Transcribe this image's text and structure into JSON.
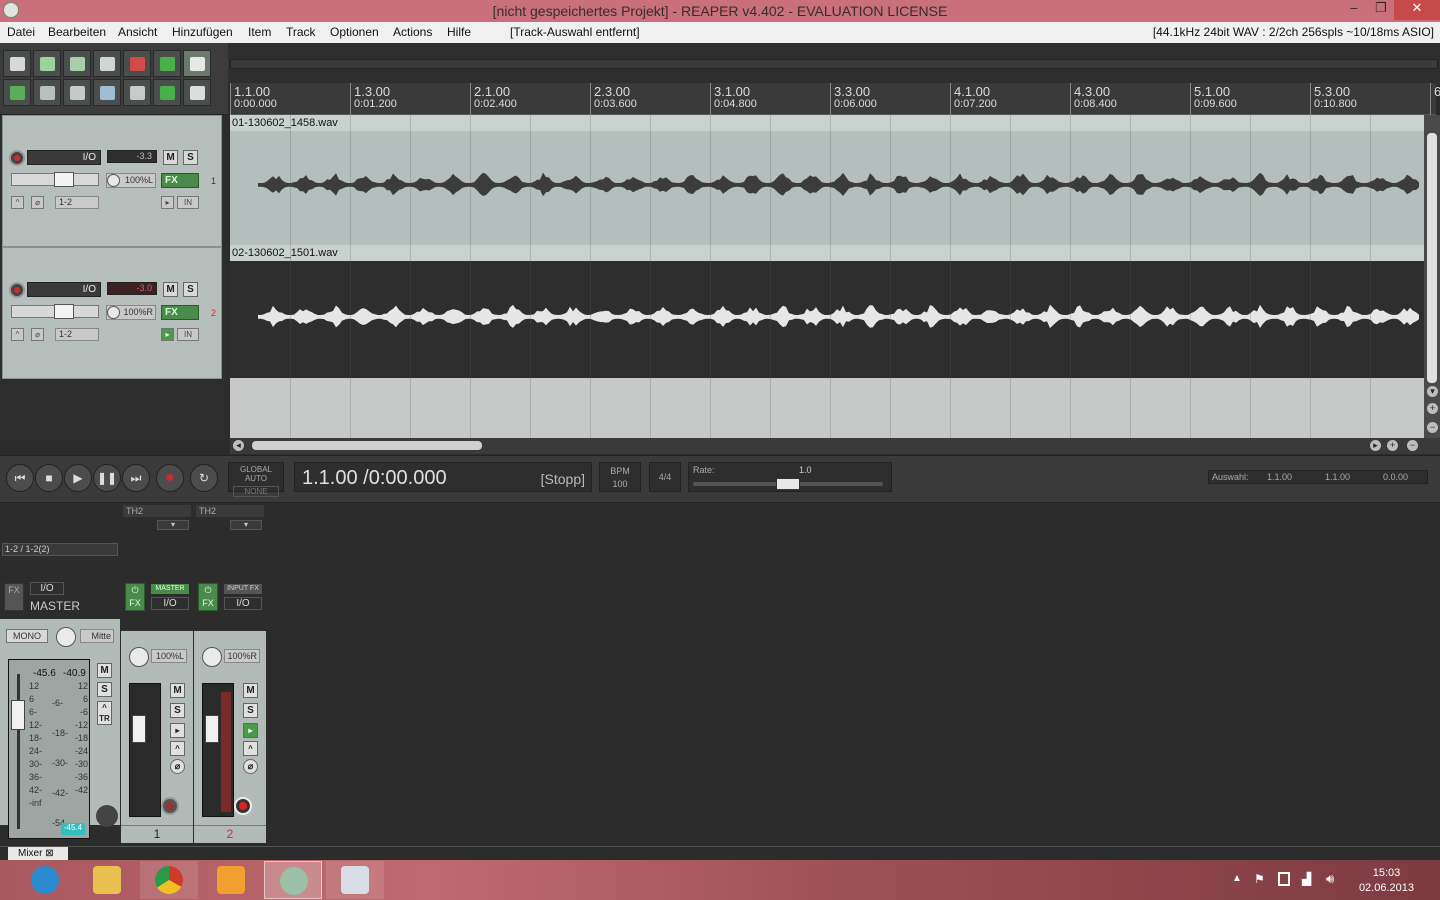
{
  "window": {
    "title": "[nicht gespeichertes Projekt] - REAPER v4.402 - EVALUATION LICENSE",
    "controls": [
      "–",
      "❐",
      "✕"
    ]
  },
  "menu": {
    "items": [
      "Datei",
      "Bearbeiten",
      "Ansicht",
      "Hinzufügen",
      "Item",
      "Track",
      "Optionen",
      "Actions",
      "Hilfe"
    ],
    "status": "[Track-Auswahl entfernt]",
    "audio_info": "[44.1kHz 24bit WAV : 2/2ch 256spls ~10/18ms ASIO]"
  },
  "ruler": {
    "marks": [
      {
        "bar": "1.1.00",
        "time": "0:00.000"
      },
      {
        "bar": "1.3.00",
        "time": "0:01.200"
      },
      {
        "bar": "2.1.00",
        "time": "0:02.400"
      },
      {
        "bar": "2.3.00",
        "time": "0:03.600"
      },
      {
        "bar": "3.1.00",
        "time": "0:04.800"
      },
      {
        "bar": "3.3.00",
        "time": "0:06.000"
      },
      {
        "bar": "4.1.00",
        "time": "0:07.200"
      },
      {
        "bar": "4.3.00",
        "time": "0:08.400"
      },
      {
        "bar": "5.1.00",
        "time": "0:09.600"
      },
      {
        "bar": "5.3.00",
        "time": "0:10.800"
      }
    ],
    "overflow": "6"
  },
  "tracks": [
    {
      "io": "I/O",
      "volume": "-3.3",
      "mute": "M",
      "solo": "S",
      "pan": "100%L",
      "fx": "FX",
      "route": "1-2",
      "number": "1",
      "in": "IN",
      "item": "01-130602_1458.wav"
    },
    {
      "io": "I/O",
      "volume": "-3.0",
      "mute": "M",
      "solo": "S",
      "pan": "100%R",
      "fx": "FX",
      "route": "1-2",
      "number": "2",
      "in": "IN",
      "item": "02-130602_1501.wav"
    }
  ],
  "transport": {
    "position": "1.1.00 /0:00.000",
    "state": "[Stopp]",
    "global_auto": "GLOBAL AUTO",
    "auto_mode": "NONE",
    "bpm_label": "BPM",
    "bpm": "100",
    "time_sig": "4/4",
    "rate_label": "Rate:",
    "rate": "1.0",
    "rate_level": 0.5,
    "selection_label": "Auswahl:",
    "sel_start": "1.1.00",
    "sel_end": "1.1.00",
    "sel_len": "0.0.00"
  },
  "mixer": {
    "master": {
      "name": "MASTER",
      "routing": "1-2 / 1-2(2)",
      "io": "I/O",
      "fx": "FX",
      "mono": "MONO",
      "pan": "Mitte",
      "peak_l": "-45.6",
      "peak_r": "-40.9",
      "scale_left": [
        "12",
        "6",
        "6-",
        "12-",
        "18-",
        "24-",
        "30-",
        "36-",
        "42-",
        "-inf"
      ],
      "scale_mid": [
        "-6-",
        "-18-",
        "-30-",
        "-42-",
        "-54-"
      ],
      "scale_right": [
        "12",
        "6",
        "-6",
        "-12",
        "-18",
        "-24",
        "-30",
        "-36",
        "-42"
      ],
      "readout": "-45.4",
      "mute": "M",
      "solo": "S",
      "trim": "TR"
    },
    "channels": [
      {
        "head": "TH2",
        "send": "MASTER",
        "io": "I/O",
        "fx": "FX",
        "pan": "100%L",
        "number": "1",
        "mute": "M",
        "solo": "S"
      },
      {
        "head": "TH2",
        "send": "INPUT FX",
        "io": "I/O",
        "fx": "FX",
        "pan": "100%R",
        "number": "2",
        "mute": "M",
        "solo": "S"
      }
    ],
    "tab": "Mixer"
  },
  "taskbar": {
    "time": "15:03",
    "date": "02.06.2013"
  },
  "colors": {
    "titlebar": "#c9707c",
    "record_red": "#d02a2a",
    "fx_green": "#4a8a4a",
    "track_panel": "#b7bfbc"
  }
}
